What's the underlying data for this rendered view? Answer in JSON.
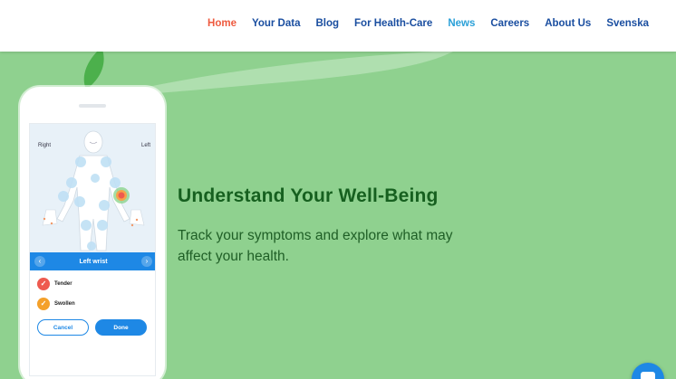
{
  "nav": {
    "items": [
      {
        "label": "Home",
        "state": "active"
      },
      {
        "label": "Your Data",
        "state": ""
      },
      {
        "label": "Blog",
        "state": ""
      },
      {
        "label": "For Health-Care",
        "state": ""
      },
      {
        "label": "News",
        "state": "highlight"
      },
      {
        "label": "Careers",
        "state": ""
      },
      {
        "label": "About Us",
        "state": ""
      },
      {
        "label": "Svenska",
        "state": ""
      }
    ]
  },
  "hero": {
    "headline": "Understand Your Well-Being",
    "subtext": "Track your symptoms and explore what may affect your health."
  },
  "phone": {
    "side_right": "Right",
    "side_left": "Left",
    "selected_joint": "Left wrist",
    "options": [
      {
        "label": "Tender",
        "color": "#ee5a4f",
        "icon": "check-icon"
      },
      {
        "label": "Swollen",
        "color": "#f4a02a",
        "icon": "check-icon"
      }
    ],
    "cancel_label": "Cancel",
    "done_label": "Done"
  },
  "colors": {
    "brand_blue": "#1e88e5",
    "nav_blue": "#1a4ea0",
    "nav_active": "#ee5a3f",
    "nav_highlight": "#2aa0d8",
    "hero_bg": "#8fd18f",
    "headline": "#16601f"
  },
  "chat": {
    "icon": "chat-bubble-icon"
  }
}
